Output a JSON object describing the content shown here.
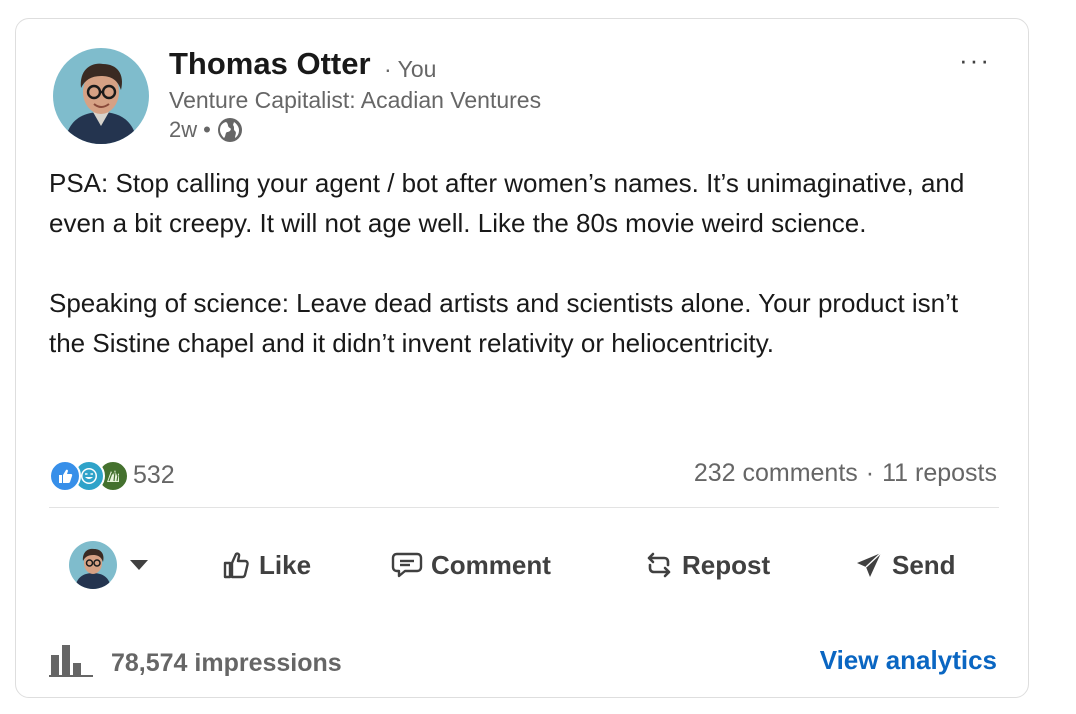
{
  "post": {
    "author": {
      "name": "Thomas Otter",
      "relation": "· You",
      "headline": "Venture Capitalist: Acadian Ventures",
      "time": "2w",
      "separator": "•",
      "visibility_icon": "globe-icon"
    },
    "menu_icon": "more-horizontal-icon",
    "more_label": "···",
    "body": "PSA: Stop calling your agent / bot after women’s names. It’s unimaginative, and even a bit creepy. It will not age well. Like the 80s movie weird science.\n\nSpeaking of science: Leave dead artists and scientists alone. Your product isn’t the Sistine chapel and it didn’t invent relativity or heliocentricity.",
    "social": {
      "reaction_icons": [
        "like-reaction-icon",
        "funny-reaction-icon",
        "celebrate-reaction-icon"
      ],
      "reaction_count": "532",
      "comments": "232 comments",
      "dot": "·",
      "reposts": "11 reposts"
    },
    "actions": {
      "like": "Like",
      "comment": "Comment",
      "repost": "Repost",
      "send": "Send"
    },
    "footer": {
      "impressions": "78,574 impressions",
      "analytics_link": "View analytics"
    }
  },
  "colors": {
    "link": "#0a66c2",
    "text_primary": "#191919",
    "text_secondary": "#666666",
    "avatar_bg": "#7fbccc"
  }
}
